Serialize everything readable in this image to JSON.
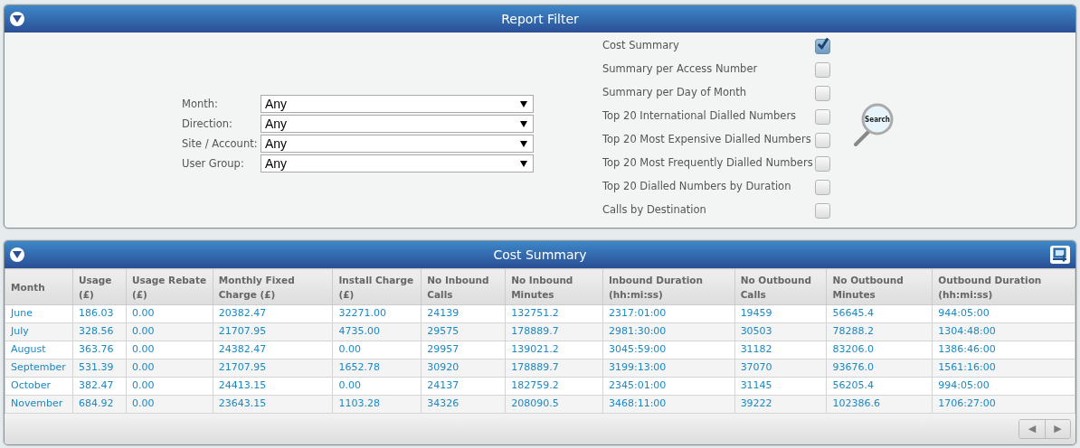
{
  "filter_panel": {
    "title": "Report Filter",
    "expanded": true,
    "fields": [
      {
        "label": "Month:",
        "value": "Any"
      },
      {
        "label": "Direction:",
        "value": "Any"
      },
      {
        "label": "Site / Account:",
        "value": "Any"
      },
      {
        "label": "User Group:",
        "value": "Any"
      }
    ],
    "reports": [
      {
        "label": "Cost Summary",
        "checked": true
      },
      {
        "label": "Summary per Access Number",
        "checked": false
      },
      {
        "label": "Summary per Day of Month",
        "checked": false
      },
      {
        "label": "Top 20 International Dialled Numbers",
        "checked": false
      },
      {
        "label": "Top 20 Most Expensive Dialled Numbers",
        "checked": false
      },
      {
        "label": "Top 20 Most Frequently Dialled Numbers",
        "checked": false
      },
      {
        "label": "Top 20 Dialled Numbers by Duration",
        "checked": false
      },
      {
        "label": "Calls by Destination",
        "checked": false
      }
    ],
    "search_button": "Search"
  },
  "summary_panel": {
    "title": "Cost Summary",
    "expanded": true,
    "table": {
      "columns": [
        "Month",
        "Usage (£)",
        "Usage Rebate (£)",
        "Monthly Fixed Charge (£)",
        "Install Charge (£)",
        "No Inbound Calls",
        "No Inbound Minutes",
        "Inbound Duration (hh:mi:ss)",
        "No Outbound Calls",
        "No Outbound Minutes",
        "Outbound Duration (hh:mi:ss)"
      ],
      "rows": [
        [
          "June",
          "186.03",
          "0.00",
          "20382.47",
          "32271.00",
          "24139",
          "132751.2",
          "2317:01:00",
          "19459",
          "56645.4",
          "944:05:00"
        ],
        [
          "July",
          "328.56",
          "0.00",
          "21707.95",
          "4735.00",
          "29575",
          "178889.7",
          "2981:30:00",
          "30503",
          "78288.2",
          "1304:48:00"
        ],
        [
          "August",
          "363.76",
          "0.00",
          "24382.47",
          "0.00",
          "29957",
          "139021.2",
          "3045:59:00",
          "31182",
          "83206.0",
          "1386:46:00"
        ],
        [
          "September",
          "531.39",
          "0.00",
          "21707.95",
          "1652.78",
          "30920",
          "178889.7",
          "3199:13:00",
          "37070",
          "93676.0",
          "1561:16:00"
        ],
        [
          "October",
          "382.47",
          "0.00",
          "24413.15",
          "0.00",
          "24137",
          "182759.2",
          "2345:01:00",
          "31145",
          "56205.4",
          "994:05:00"
        ],
        [
          "November",
          "684.92",
          "0.00",
          "23643.15",
          "1103.28",
          "34326",
          "208090.5",
          "3468:11:00",
          "39222",
          "102386.6",
          "1706:27:00"
        ]
      ]
    },
    "pager": [
      {
        "label": "◀",
        "disabled": true
      },
      {
        "label": "▶",
        "disabled": true
      }
    ]
  }
}
